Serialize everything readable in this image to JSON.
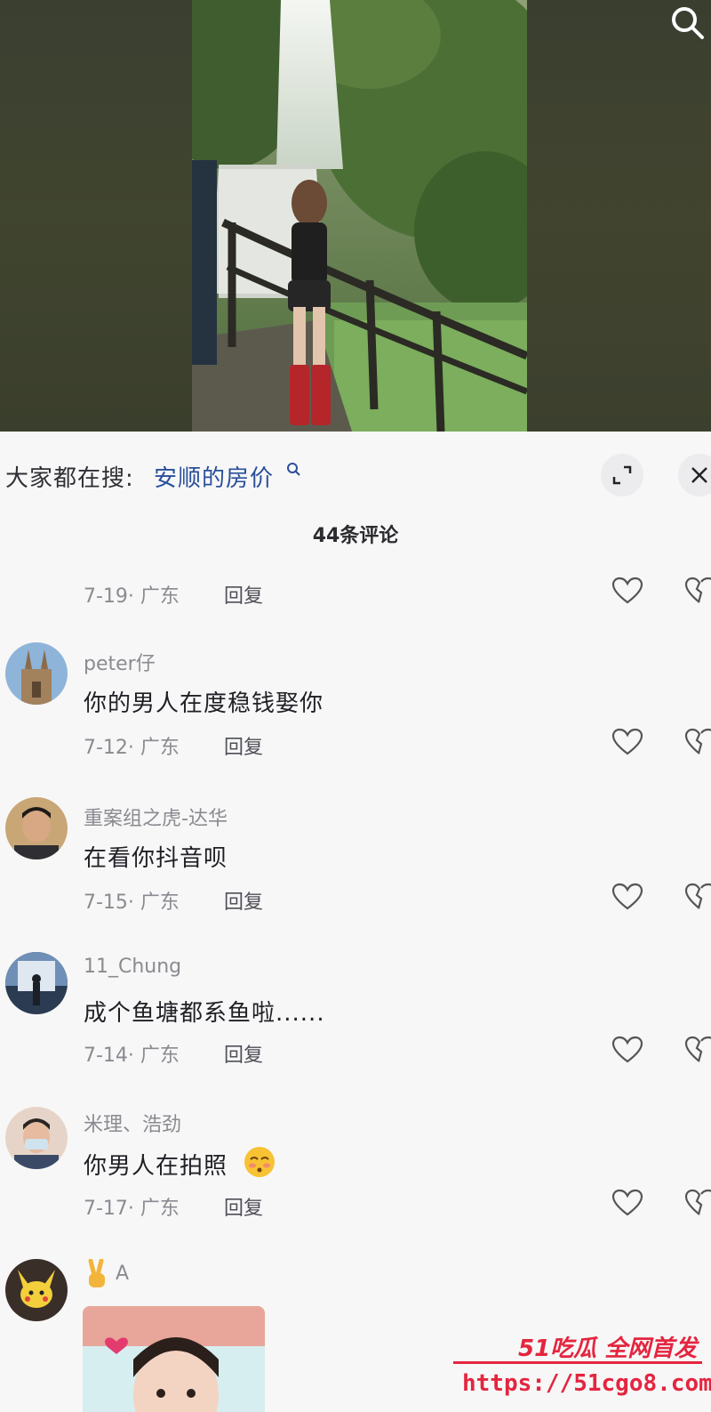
{
  "video": {
    "search_icon": "search-icon"
  },
  "hot_search": {
    "prefix": "大家都在搜:",
    "term": "安顺的房价",
    "term_icon": "search-small-icon",
    "expand_icon": "expand-icon",
    "close_icon": "close-icon"
  },
  "comments_header": {
    "count_label": "44条评论"
  },
  "comments": [
    {
      "name": "",
      "text": "",
      "meta": "7-19· 广东",
      "reply": "回复"
    },
    {
      "name": "peter仔",
      "text": "你的男人在度稳钱娶你",
      "meta": "7-12· 广东",
      "reply": "回复"
    },
    {
      "name": "重案组之虎-达华",
      "text": "在看你抖音呗",
      "meta": "7-15· 广东",
      "reply": "回复"
    },
    {
      "name": "11_Chung",
      "text": "成个鱼塘都系鱼啦......",
      "meta": "7-14· 广东",
      "reply": "回复"
    },
    {
      "name": "米理、浩劲",
      "text": "你男人在拍照",
      "meta": "7-17· 广东",
      "reply": "回复"
    },
    {
      "name": "A",
      "text": "",
      "meta": "",
      "reply": ""
    }
  ],
  "watermark": {
    "title": "51吃瓜 全网首发",
    "url": "https://51cgo8.com"
  },
  "colors": {
    "link_blue": "#2a4f9a",
    "watermark_red": "#e4253f"
  }
}
